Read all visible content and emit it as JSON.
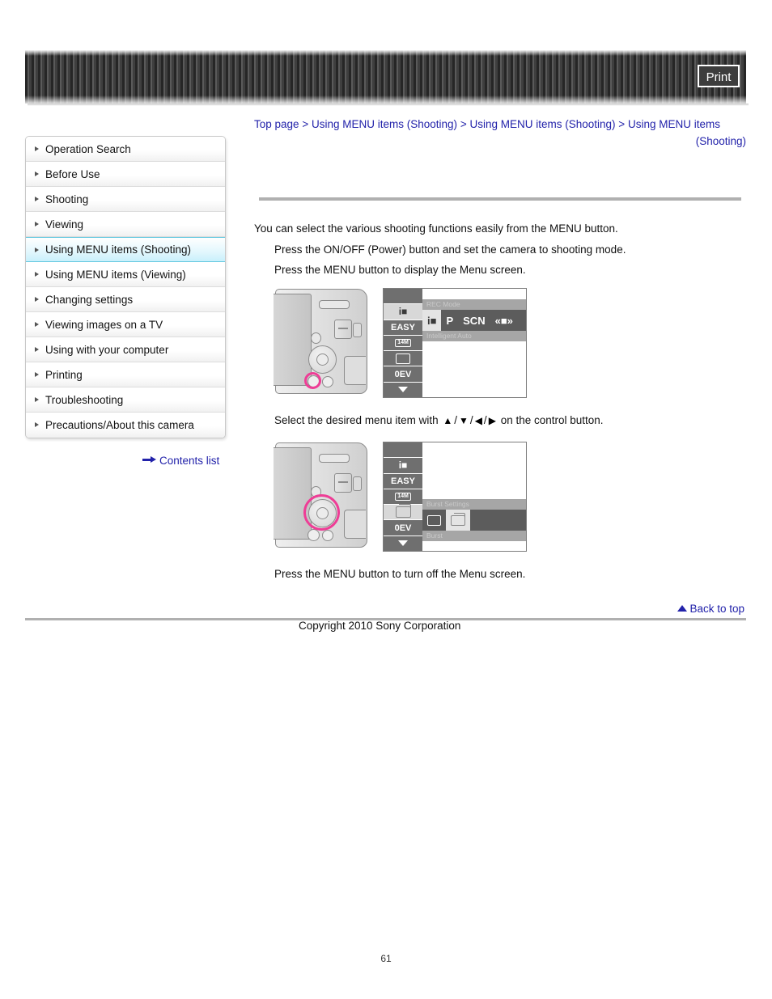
{
  "banner": {
    "print_label": "Print"
  },
  "breadcrumb": {
    "items": [
      "Top page",
      "Using MENU items (Shooting)",
      "Using MENU items (Shooting)",
      "Using MENU items"
    ],
    "separator": ">",
    "tail": "(Shooting)"
  },
  "sidebar": {
    "items": [
      {
        "label": "Operation Search",
        "active": false
      },
      {
        "label": "Before Use",
        "active": false
      },
      {
        "label": "Shooting",
        "active": false
      },
      {
        "label": "Viewing",
        "active": false
      },
      {
        "label": "Using MENU items (Shooting)",
        "active": true
      },
      {
        "label": "Using MENU items (Viewing)",
        "active": false
      },
      {
        "label": "Changing settings",
        "active": false
      },
      {
        "label": "Viewing images on a TV",
        "active": false
      },
      {
        "label": "Using with your computer",
        "active": false
      },
      {
        "label": "Printing",
        "active": false
      },
      {
        "label": "Troubleshooting",
        "active": false
      },
      {
        "label": "Precautions/About this camera",
        "active": false
      }
    ],
    "contents_list_label": "Contents list"
  },
  "main": {
    "intro": "You can select the various shooting functions easily from the MENU button.",
    "step1": "Press the ON/OFF (Power) button and set the camera to shooting mode.",
    "step2": "Press the MENU button to display the Menu screen.",
    "select_prefix": "Select the desired menu item with",
    "select_glyphs": [
      "▲",
      "/",
      "▼",
      "/",
      "◀",
      "/",
      "▶"
    ],
    "select_suffix": "on the control button.",
    "last_step": "Press the MENU button to turn off the Menu screen."
  },
  "figure1": {
    "rail": [
      {
        "label": "",
        "selected": false,
        "kind": "blank"
      },
      {
        "label": "i■",
        "selected": true,
        "kind": "icam"
      },
      {
        "label": "EASY",
        "selected": false,
        "kind": "text"
      },
      {
        "label": "14M",
        "selected": false,
        "kind": "badge"
      },
      {
        "label": "",
        "selected": false,
        "kind": "rect"
      },
      {
        "label": "0EV",
        "selected": false,
        "kind": "ev"
      },
      {
        "label": "",
        "selected": false,
        "kind": "caret"
      }
    ],
    "panel_title": "REC Mode",
    "options": [
      "i■",
      "P",
      "SCN",
      "«■»"
    ],
    "selected_option": "i■",
    "panel_sub": "Intelligent Auto"
  },
  "figure2": {
    "rail": [
      {
        "label": "",
        "selected": false,
        "kind": "blank"
      },
      {
        "label": "i■",
        "selected": false,
        "kind": "icam"
      },
      {
        "label": "EASY",
        "selected": false,
        "kind": "text"
      },
      {
        "label": "14M",
        "selected": false,
        "kind": "badge"
      },
      {
        "label": "",
        "selected": true,
        "kind": "burst"
      },
      {
        "label": "0EV",
        "selected": false,
        "kind": "ev"
      },
      {
        "label": "",
        "selected": false,
        "kind": "caret"
      }
    ],
    "panel_title": "Burst Settings",
    "options": [
      "single",
      "burst"
    ],
    "selected_option": "burst",
    "panel_sub": "Burst"
  },
  "footer": {
    "back_to_top": "Back to top",
    "copyright": "Copyright 2010 Sony Corporation",
    "page_number": "61"
  },
  "colors": {
    "link": "#2222aa",
    "highlight_ring": "#ee3d96",
    "active_nav": "#c9f0fb",
    "rule": "#b0b0b0"
  }
}
